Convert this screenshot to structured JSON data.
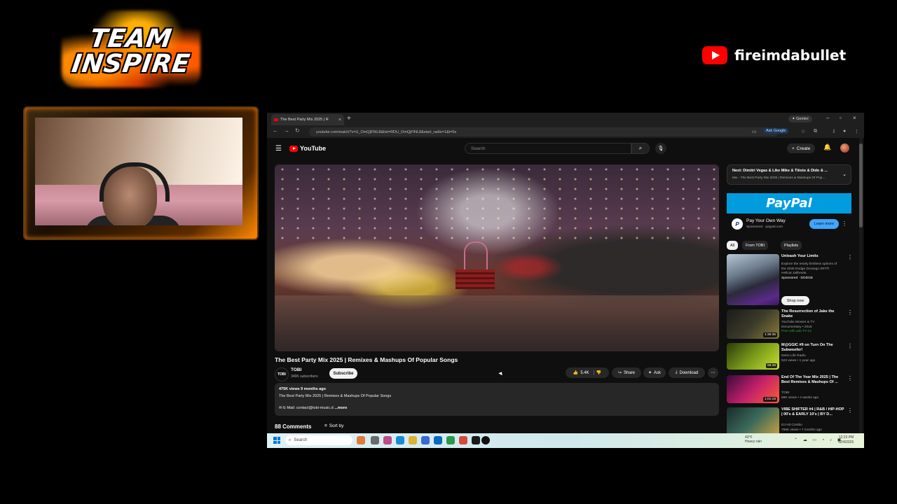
{
  "overlay": {
    "team_logo_line1": "TEAM",
    "team_logo_line2": "INSPIRE",
    "channel_brand": "fireimdabullet"
  },
  "browser": {
    "tab_title": "The Best Party Mix 2025 | R",
    "gemini_label": "Gemini",
    "url": "youtube.com/watch?v=U_OmQjFlNL8&list=RDU_OmQjFlNL8&start_radio=1&t=5s",
    "ask_google_label": "Ask Google"
  },
  "youtube": {
    "logo_text": "YouTube",
    "search_placeholder": "Search",
    "create_label": "Create",
    "video": {
      "title": "The Best Party Mix 2025 | Remixes & Mashups Of Popular Songs",
      "channel_avatar_text": "TOBI",
      "channel_name": "TOBI",
      "subscribers": "349K subscribers",
      "subscribe_label": "Subscribe",
      "likes": "5.4K",
      "share_label": "Share",
      "ask_label": "Ask",
      "download_label": "Download"
    },
    "description": {
      "meta": "475K views  9 months ago",
      "line1": "The Best Party Mix 2025 | Remixes & Mashups Of Popular Songs",
      "email": "E-Mail: contact@tobi-music.d",
      "more": "...more"
    },
    "comments": {
      "count_label": "88 Comments",
      "sort_label": "Sort by"
    },
    "up_next": {
      "title": "Next: Dimitri Vegas & Like Mike & Tiësto & Dido & ...",
      "subtitle": "Mix - The Best Party Mix 2025 | Remixes & Mashups Of Pop..."
    },
    "ad": {
      "banner_text": "PayPal",
      "logo_letter": "P",
      "title": "Pay Your Own Way",
      "sponsored": "Sponsored · paypal.com",
      "cta": "Learn more"
    },
    "chips": [
      "All",
      "From TOBI",
      "Playlists"
    ],
    "recommendations": [
      {
        "title": "Unleash Your Limits",
        "meta1": "Explore the nearly limitless options of",
        "meta2": "the 2026 Dodge Durango SRT®",
        "meta3": "Hellcat Jailbreak.",
        "meta4": "Sponsored · DODGE",
        "cta": "Shop now",
        "duration": ""
      },
      {
        "title": "The Resurrection of Jake the Snake",
        "meta1": "YouTube Movies & TV",
        "meta2": "Documentary • 2016",
        "meta3": "Free with ads   TV-14",
        "duration": "1:36:35"
      },
      {
        "title": "M@GGIC #9 on Turn On The Subwoofer!",
        "meta1": "Netro Life Radio",
        "meta2": "523 views • 1 year ago",
        "duration": "59:49"
      },
      {
        "title": "End Of The Year Mix 2025 | The Best Remixes & Mashups Of ...",
        "meta1": "TOBI",
        "meta2": "68K views • 4 weeks ago",
        "duration": "1:01:18"
      },
      {
        "title": "VIBE SHIFTER #4 | R&B / HIP-HOP | 00's & EARLY 10's | BY D...",
        "meta1": "DJ Hit Combo",
        "meta2": "796K views • 7 months ago",
        "duration": ""
      }
    ]
  },
  "taskbar": {
    "search_placeholder": "Search",
    "weather_temp": "43°F",
    "weather_desc": "Heavy rain",
    "time": "12:23 PM",
    "date": "12/4/2025"
  },
  "colors": {
    "youtube_red": "#ff0000",
    "paypal_blue": "#009cde",
    "learn_more_blue": "#3ea6ff"
  }
}
